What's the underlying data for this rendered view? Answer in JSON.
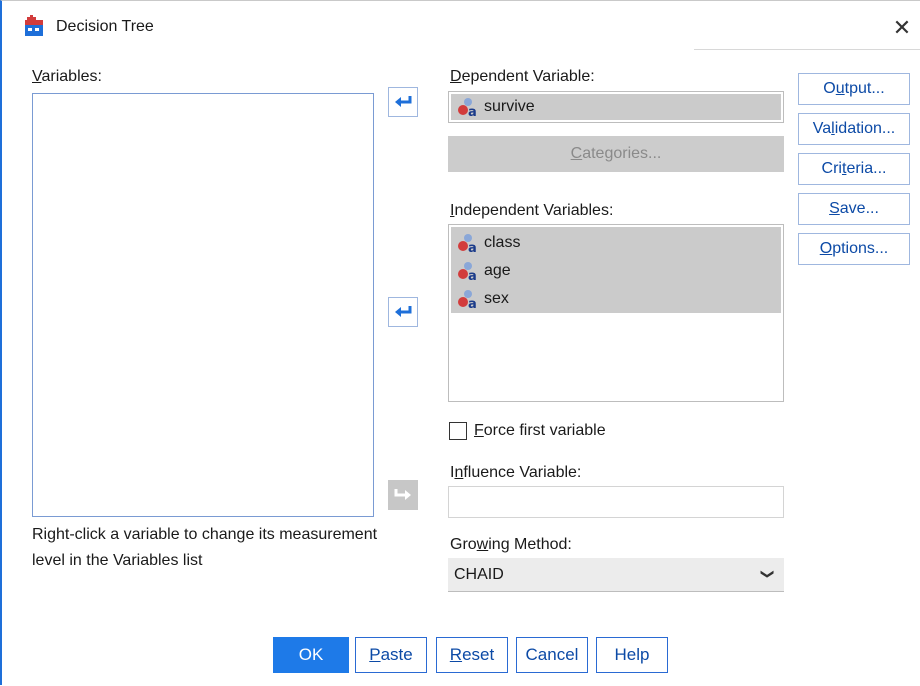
{
  "window": {
    "title": "Decision Tree",
    "close_glyph": "✕"
  },
  "variables": {
    "label_underlined": "V",
    "label_rest": "ariables:",
    "items": [],
    "hint": "Right-click a variable to change its measurement level in the Variables list"
  },
  "dependent": {
    "label_underlined": "D",
    "label_rest": "ependent Variable:",
    "value": "survive",
    "categories_underlined": "C",
    "categories_rest": "ategories..."
  },
  "independent": {
    "label_underlined": "I",
    "label_rest": "ndependent Variables:",
    "items": [
      "class",
      "age",
      "sex"
    ]
  },
  "force_first": {
    "label_underlined": "F",
    "label_rest": "orce first variable",
    "checked": false
  },
  "influence": {
    "label_pre": "I",
    "label_underlined": "n",
    "label_rest": "fluence Variable:",
    "value": ""
  },
  "growing": {
    "label_pre": "Gro",
    "label_underlined": "w",
    "label_rest": "ing Method:",
    "value": "CHAID"
  },
  "side_buttons": {
    "output": {
      "pre": "O",
      "u": "u",
      "post": "tput..."
    },
    "validation": {
      "pre": "Va",
      "u": "l",
      "post": "idation..."
    },
    "criteria": {
      "pre": "Cri",
      "u": "t",
      "post": "eria..."
    },
    "save": {
      "pre": "",
      "u": "S",
      "post": "ave..."
    },
    "options": {
      "pre": "",
      "u": "O",
      "post": "ptions..."
    }
  },
  "bottom_buttons": {
    "ok": "OK",
    "paste": {
      "u": "P",
      "post": "aste"
    },
    "reset": {
      "u": "R",
      "post": "eset"
    },
    "cancel": "Cancel",
    "help": "Help"
  },
  "icons": {
    "app": "decision-tree-app-icon",
    "nominal_variable": "nominal-variable-icon",
    "move_arrow": "move-arrow-icon"
  },
  "colors": {
    "accent": "#1e7ae8",
    "link_text": "#0c4aa6",
    "selection_gray": "#cbcbcb"
  }
}
